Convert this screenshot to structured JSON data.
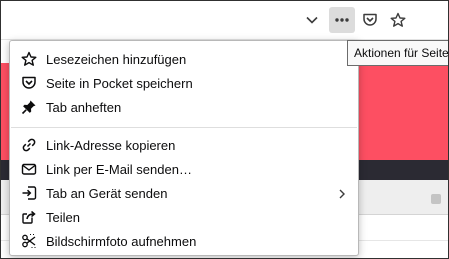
{
  "toolbar": {
    "dropdown_icon": "chevron-down-icon",
    "page_actions_icon": "ellipsis-icon",
    "pocket_icon": "pocket-icon",
    "bookmark_icon": "star-icon"
  },
  "tooltip": {
    "text": "Aktionen für Seite"
  },
  "menu": {
    "items": [
      {
        "label": "Lesezeichen hinzufügen",
        "icon": "star-icon"
      },
      {
        "label": "Seite in Pocket speichern",
        "icon": "pocket-icon"
      },
      {
        "label": "Tab anheften",
        "icon": "pin-icon"
      },
      {
        "label": "Link-Adresse kopieren",
        "icon": "link-icon"
      },
      {
        "label": "Link per E-Mail senden…",
        "icon": "mail-icon"
      },
      {
        "label": "Tab an Gerät senden",
        "icon": "send-to-device-icon",
        "has_submenu": true
      },
      {
        "label": "Teilen",
        "icon": "share-icon"
      },
      {
        "label": "Bildschirmfoto aufnehmen",
        "icon": "screenshot-icon"
      }
    ]
  },
  "colors": {
    "page_accent": "#fd4f62",
    "page_dark_band": "#2b2a33",
    "active_button_bg": "#dcdcdc"
  }
}
